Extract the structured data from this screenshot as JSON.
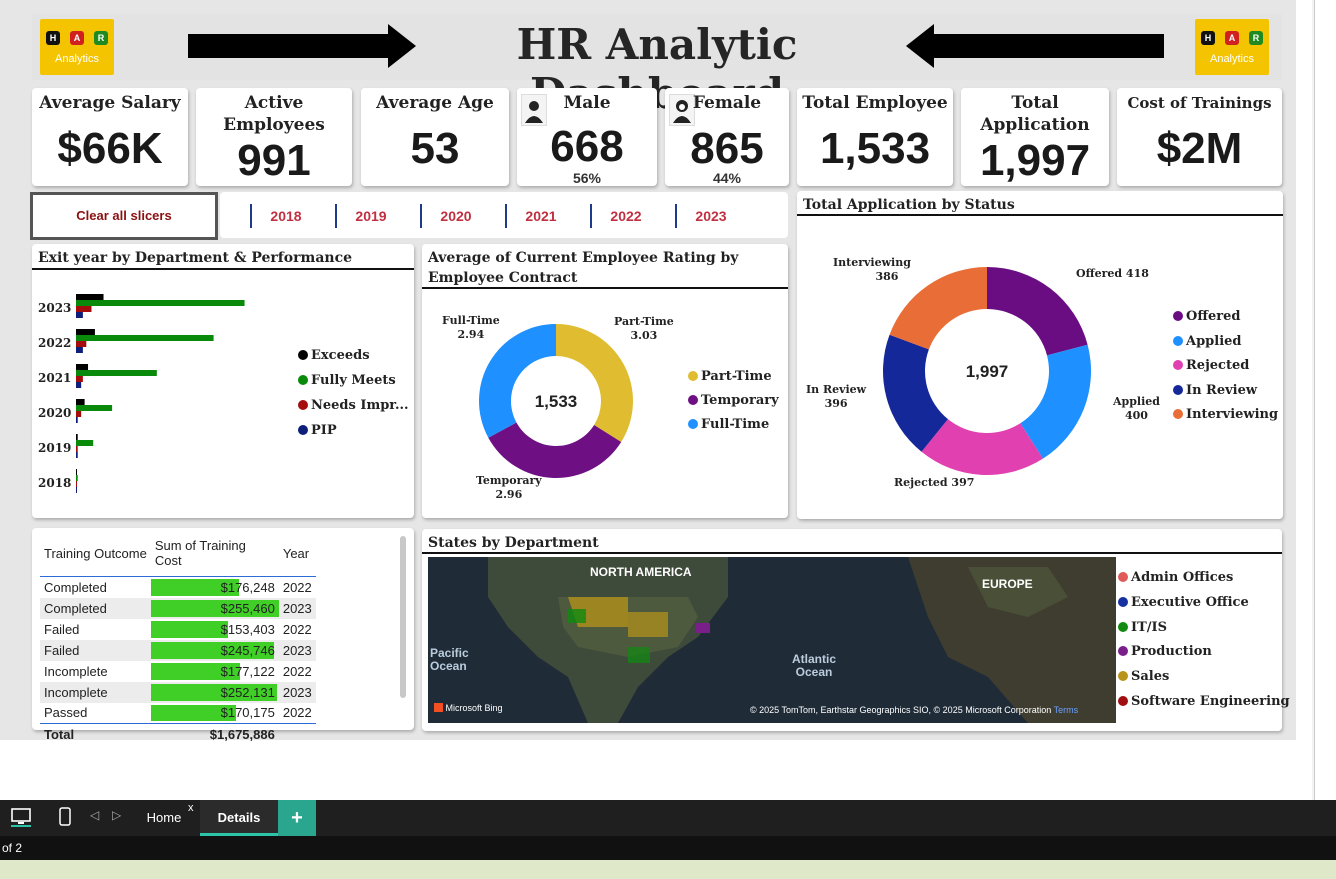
{
  "header": {
    "title": "HR Analytic Dashboard",
    "logo_letters": [
      "H",
      "A",
      "R"
    ],
    "logo_label": "Analytics"
  },
  "kpis": {
    "avg_salary": {
      "label": "Average Salary",
      "value": "$66K"
    },
    "active": {
      "label": "Active Employees",
      "value": "991"
    },
    "avg_age": {
      "label": "Average Age",
      "value": "53"
    },
    "male": {
      "label": "Male",
      "value": "668",
      "pct": "56%"
    },
    "female": {
      "label": "Female",
      "value": "865",
      "pct": "44%"
    },
    "total_emp": {
      "label": "Total Employee",
      "value": "1,533"
    },
    "total_app": {
      "label": "Total Application",
      "value": "1,997"
    },
    "trainings": {
      "label": "Cost of Trainings",
      "value": "$2M"
    }
  },
  "slicer": {
    "clear_label": "Clear all slicers",
    "years": [
      "2018",
      "2019",
      "2020",
      "2021",
      "2022",
      "2023"
    ]
  },
  "chart_data": [
    {
      "type": "bar",
      "title": "Exit year by Department & Performance",
      "orientation": "horizontal",
      "categories": [
        "2023",
        "2022",
        "2021",
        "2020",
        "2019",
        "2018"
      ],
      "series": [
        {
          "name": "Exceeds",
          "color": "#000000",
          "values": [
            16,
            11,
            7,
            5,
            1,
            0
          ]
        },
        {
          "name": "Fully Meets",
          "color": "#0a8a0a",
          "values": [
            98,
            80,
            47,
            21,
            10,
            1
          ]
        },
        {
          "name": "Needs Impr...",
          "color": "#a50d0d",
          "values": [
            9,
            6,
            4,
            3,
            1,
            0
          ]
        },
        {
          "name": "PIP",
          "color": "#0d1f7a",
          "values": [
            4,
            4,
            3,
            1,
            1,
            0
          ]
        }
      ]
    },
    {
      "type": "pie",
      "title": "Average of Current Employee Rating by Employee Contract",
      "center_label": "1,533",
      "slices": [
        {
          "name": "Part-Time",
          "value": 3.03,
          "color": "#e0bd30"
        },
        {
          "name": "Temporary",
          "value": 2.96,
          "color": "#6e0f84"
        },
        {
          "name": "Full-Time",
          "value": 2.94,
          "color": "#1e90ff"
        }
      ]
    },
    {
      "type": "pie",
      "title": "Total Application by Status",
      "center_label": "1,997",
      "slices": [
        {
          "name": "Offered",
          "value": 418,
          "color": "#6a0d83"
        },
        {
          "name": "Applied",
          "value": 400,
          "color": "#1e90ff"
        },
        {
          "name": "Rejected",
          "value": 397,
          "color": "#e040b0"
        },
        {
          "name": "In Review",
          "value": 396,
          "color": "#15289a"
        },
        {
          "name": "Interviewing",
          "value": 386,
          "color": "#e86d36"
        }
      ]
    }
  ],
  "exit_chart_labels": {
    "rating_annotations": {
      "fulltime_name": "Full-Time",
      "fulltime_val": "2.94",
      "parttime_name": "Part-Time",
      "parttime_val": "3.03",
      "temporary_name": "Temporary",
      "temporary_val": "2.96"
    },
    "status_annotations": {
      "interviewing_name": "Interviewing",
      "interviewing_val": "386",
      "offered": "Offered 418",
      "inreview_name": "In Review",
      "inreview_val": "396",
      "applied_name": "Applied",
      "applied_val": "400",
      "rejected": "Rejected 397"
    }
  },
  "training_table": {
    "headers": [
      "Training Outcome",
      "Sum of Training Cost",
      "Year"
    ],
    "rows": [
      {
        "outcome": "Completed",
        "cost": "$176,248",
        "cost_value": 176248,
        "year": "2022"
      },
      {
        "outcome": "Completed",
        "cost": "$255,460",
        "cost_value": 255460,
        "year": "2023"
      },
      {
        "outcome": "Failed",
        "cost": "$153,403",
        "cost_value": 153403,
        "year": "2022"
      },
      {
        "outcome": "Failed",
        "cost": "$245,746",
        "cost_value": 245746,
        "year": "2023"
      },
      {
        "outcome": "Incomplete",
        "cost": "$177,122",
        "cost_value": 177122,
        "year": "2022"
      },
      {
        "outcome": "Incomplete",
        "cost": "$252,131",
        "cost_value": 252131,
        "year": "2023"
      },
      {
        "outcome": "Passed",
        "cost": "$170,175",
        "cost_value": 170175,
        "year": "2022"
      }
    ],
    "total_label": "Total",
    "total_value": "$1,675,886"
  },
  "map": {
    "title": "States by Department",
    "labels": {
      "na": "NORTH AMERICA",
      "eu": "EUROPE",
      "pacific": "Pacific Ocean",
      "atlantic": "Atlantic Ocean"
    },
    "credit": "Microsoft Bing",
    "copyright": "© 2025 TomTom, Earthstar Geographics SIO, © 2025 Microsoft Corporation",
    "terms": "Terms",
    "legend": [
      {
        "name": "Admin Offices",
        "color": "#e05a5a"
      },
      {
        "name": "Executive Office",
        "color": "#1530a0"
      },
      {
        "name": "IT/IS",
        "color": "#108a10"
      },
      {
        "name": "Production",
        "color": "#7a1f8a"
      },
      {
        "name": "Sales",
        "color": "#b8941a"
      },
      {
        "name": "Software Engineering",
        "color": "#a01010"
      }
    ]
  },
  "tabs": {
    "home": "Home",
    "details": "Details",
    "add": "+",
    "close": "x"
  },
  "status": {
    "page": "of 2"
  }
}
